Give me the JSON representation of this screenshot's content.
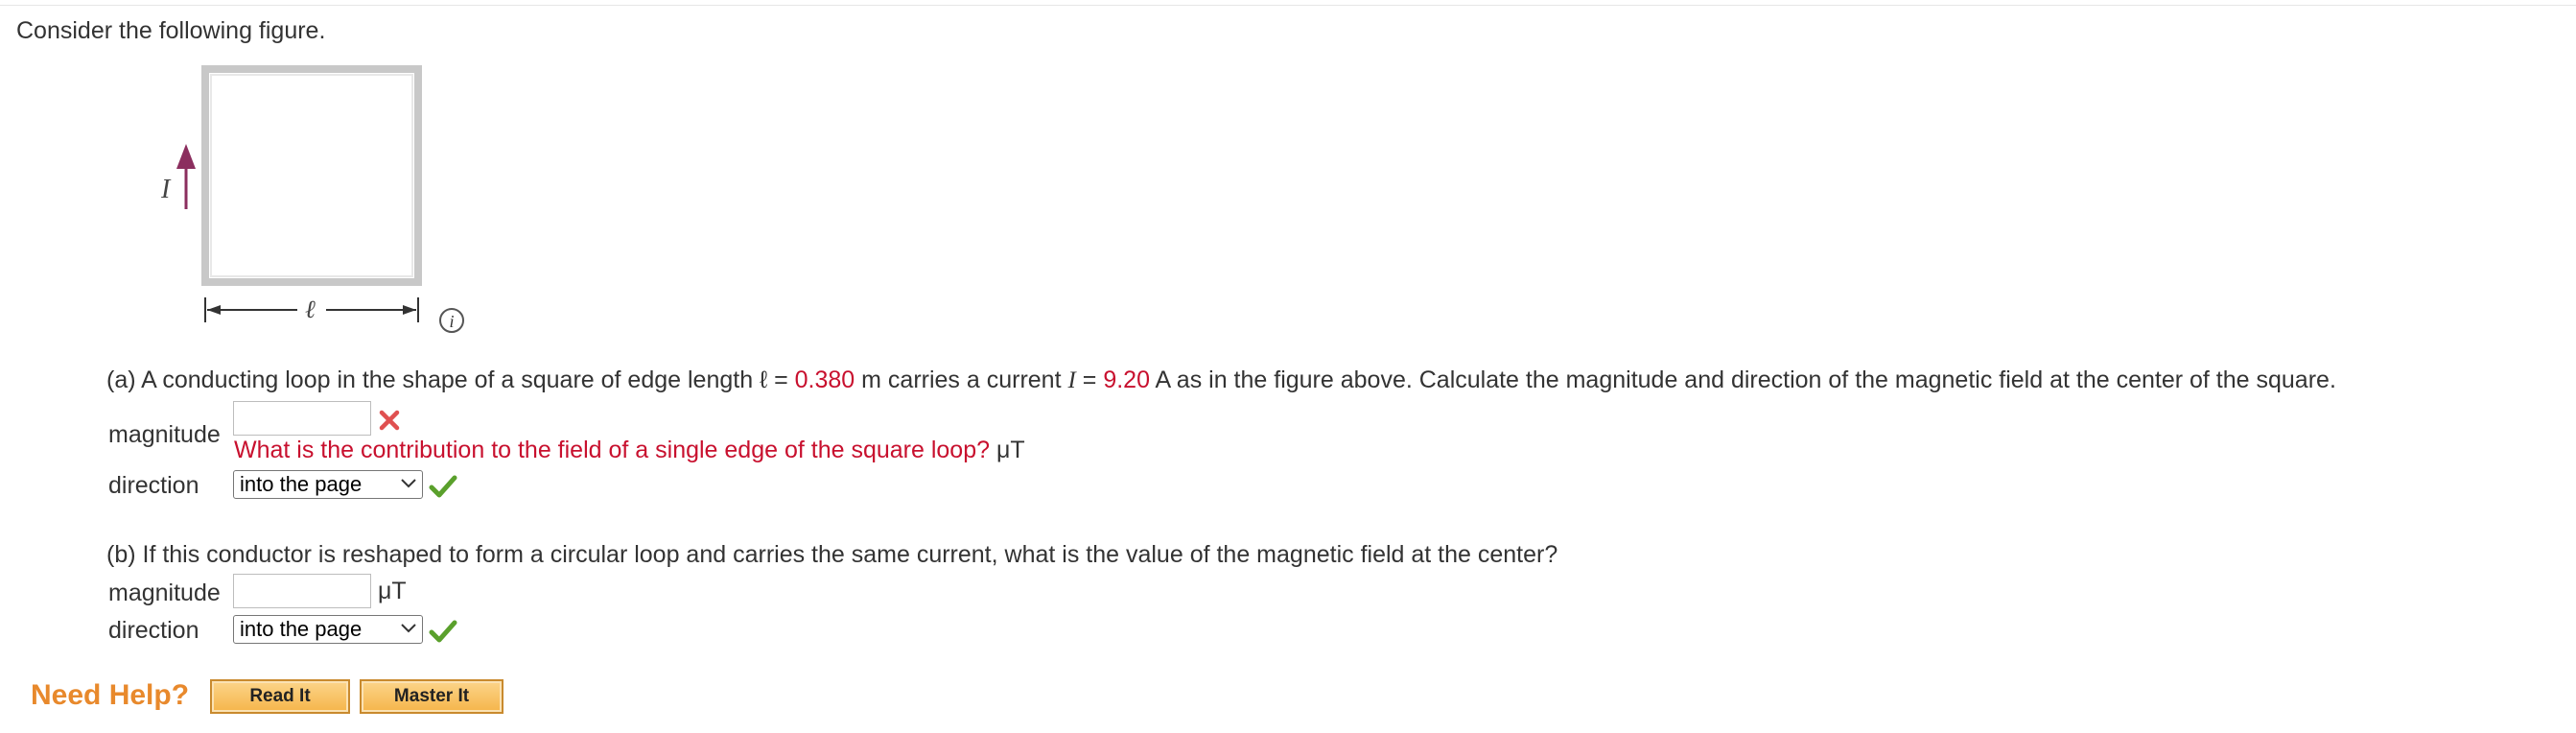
{
  "intro": "Consider the following figure.",
  "figure": {
    "current_symbol": "I",
    "length_symbol": "ℓ"
  },
  "part_a": {
    "q_prefix": "(a) A conducting loop in the shape of a square of edge length ℓ = ",
    "edge_length_value": "0.380",
    "q_mid1": " m carries a current ",
    "current_symbol": "I",
    "q_mid2": " = ",
    "current_value": "9.20",
    "q_suffix": " A as in the figure above. Calculate the magnitude and direction of the magnetic field at the center of the square.",
    "magnitude_label": "magnitude",
    "magnitude_value": "",
    "feedback": "What is the contribution to the field of a single edge of the square loop?",
    "unit": "μT",
    "direction_label": "direction",
    "direction_value": "into the page",
    "magnitude_status_icon": "x-mark-icon",
    "direction_status_icon": "check-mark-icon"
  },
  "part_b": {
    "question": "(b) If this conductor is reshaped to form a circular loop and carries the same current, what is the value of the magnetic field at the center?",
    "magnitude_label": "magnitude",
    "magnitude_value": "",
    "unit": "μT",
    "direction_label": "direction",
    "direction_value": "into the page",
    "direction_status_icon": "check-mark-icon"
  },
  "help": {
    "label": "Need Help?",
    "read_it": "Read It",
    "master_it": "Master It"
  },
  "colors": {
    "given_value": "#c8102e",
    "arrow": "#8b2e5e",
    "help_text": "#e8892c",
    "check": "#5aa02c",
    "x_mark": "#e05050"
  }
}
